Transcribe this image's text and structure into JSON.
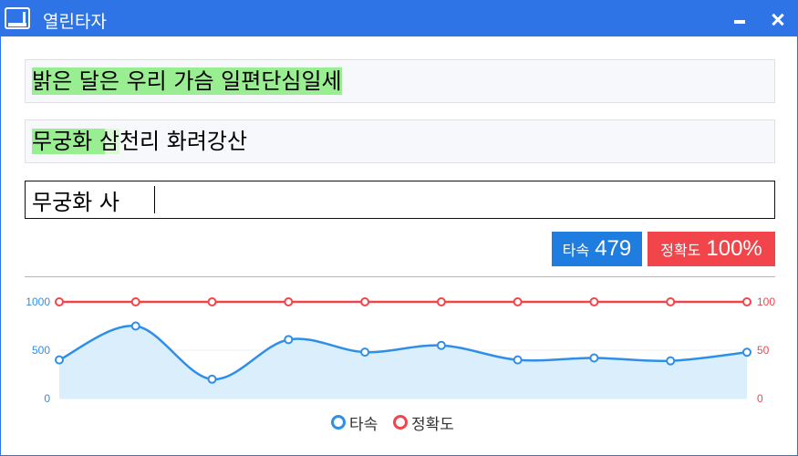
{
  "window": {
    "title": "열린타자",
    "app_icon": "keyboard-app-icon",
    "titlebar_color": "#2f74e6"
  },
  "practice": {
    "previous_line": "밝은 달은 우리 가슴 일편단심일세",
    "current_line_typed_part": "무궁화 ",
    "current_line_cursor_char": "삼",
    "current_line_rest": "천리 화려강산",
    "input_value": "무궁화 사",
    "highlight_color": "#98ee90"
  },
  "stats": {
    "speed_label": "타속",
    "speed_value": "479",
    "accuracy_label": "정확도",
    "accuracy_value": "100%",
    "speed_color": "#1f7de0",
    "accuracy_color": "#f1454b"
  },
  "chart_data": {
    "type": "line",
    "x": [
      1,
      2,
      3,
      4,
      5,
      6,
      7,
      8,
      9,
      10
    ],
    "series": [
      {
        "name": "타속",
        "axis": "left",
        "color": "#2f8fe8",
        "smooth": true,
        "area": true,
        "values": [
          400,
          750,
          200,
          610,
          480,
          550,
          400,
          420,
          390,
          479
        ]
      },
      {
        "name": "정확도",
        "axis": "right",
        "color": "#f1454b",
        "smooth": false,
        "area": false,
        "values": [
          100,
          100,
          100,
          100,
          100,
          100,
          100,
          100,
          100,
          100
        ]
      }
    ],
    "yleft": {
      "ticks": [
        "0",
        "500",
        "1000"
      ],
      "range": [
        0,
        1000
      ]
    },
    "yright": {
      "ticks": [
        "0",
        "50",
        "100"
      ],
      "range": [
        0,
        100
      ]
    },
    "grid": true,
    "legend_position": "bottom-center"
  }
}
